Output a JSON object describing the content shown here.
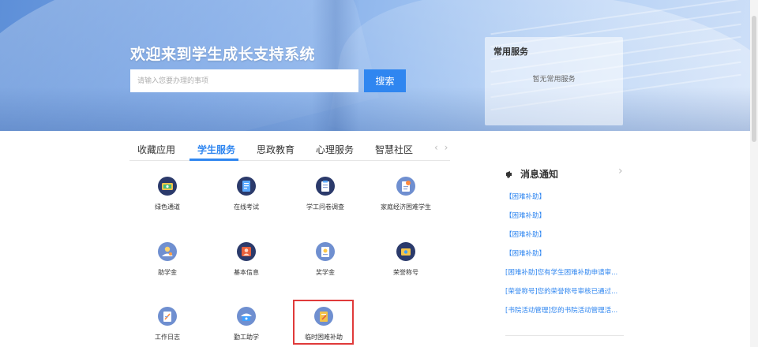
{
  "hero": {
    "welcome": "欢迎来到学生成长支持系统",
    "search_placeholder": "请输入您要办理的事项",
    "search_button": "搜索"
  },
  "common_services": {
    "title": "常用服务",
    "empty_text": "暂无常用服务"
  },
  "tabs": [
    {
      "label": "收藏应用",
      "active": false
    },
    {
      "label": "学生服务",
      "active": true
    },
    {
      "label": "思政教育",
      "active": false
    },
    {
      "label": "心理服务",
      "active": false
    },
    {
      "label": "智慧社区",
      "active": false
    }
  ],
  "tab_arrows": "‹ ›",
  "services": [
    {
      "label": "绿色通道",
      "icon": "green-channel-icon"
    },
    {
      "label": "在线考试",
      "icon": "online-exam-icon"
    },
    {
      "label": "学工问卷调查",
      "icon": "questionnaire-icon"
    },
    {
      "label": "家庭经济困难学生",
      "icon": "financial-hardship-icon"
    },
    {
      "label": "助学金",
      "icon": "grant-icon"
    },
    {
      "label": "基本信息",
      "icon": "basic-info-icon"
    },
    {
      "label": "奖学金",
      "icon": "scholarship-icon"
    },
    {
      "label": "荣誉称号",
      "icon": "honor-title-icon"
    },
    {
      "label": "工作日志",
      "icon": "work-log-icon"
    },
    {
      "label": "勤工助学",
      "icon": "work-study-icon"
    },
    {
      "label": "临时困难补助",
      "icon": "temporary-subsidy-icon"
    }
  ],
  "notices": {
    "title": "消息通知",
    "more": "›",
    "items": [
      "【困难补助】",
      "【困难补助】",
      "【困难补助】",
      "【困难补助】",
      "[困难补助]您有学生困难补助申请审...",
      "[荣誉称号]您的荣誉称号审核已通过...",
      "[书院活动管理]您的书院活动管理活..."
    ]
  },
  "colors": {
    "accent": "#2f86f0",
    "highlight": "#e03a3a",
    "icon_bg": "#2b3a6b"
  }
}
